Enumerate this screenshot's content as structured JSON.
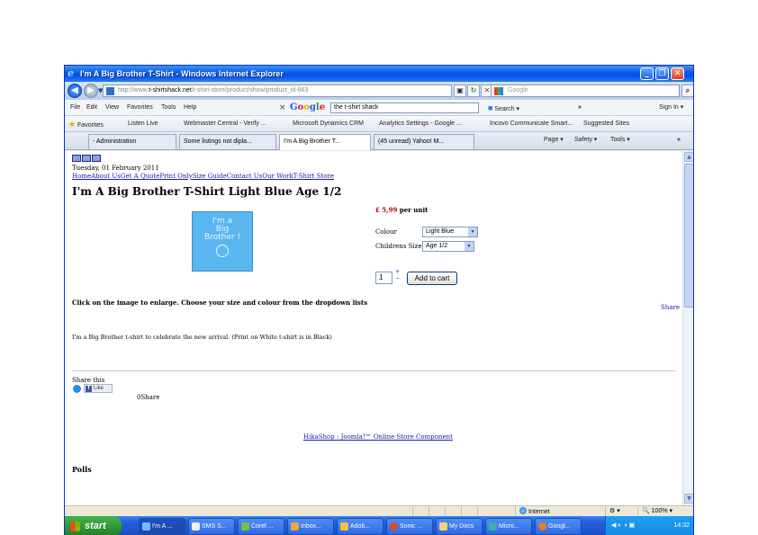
{
  "window": {
    "title": "I'm A Big Brother T-Shirt - Windows Internet Explorer",
    "controls": [
      "_",
      "❐",
      "✕"
    ]
  },
  "address": {
    "scheme": "http://www.",
    "host": "t-shirtshack.net",
    "path": "/t-shirt-store/product/show/product_id-663",
    "search_placeholder": "Google"
  },
  "menu": {
    "items": [
      "File",
      "Edit",
      "View",
      "Favorites",
      "Tools",
      "Help"
    ],
    "google_search_value": "the t-shirt shack",
    "search_label": "Search",
    "sign_in": "Sign In"
  },
  "favorites": {
    "label": "Favorites",
    "links": [
      "Listen Live",
      "Webmaster Central - Verify ...",
      "Microsoft Dynamics CRM",
      "Analytics Settings - Google ...",
      "Incovo  Communicate Smart...",
      "Suggested Sites"
    ]
  },
  "tabs": {
    "items": [
      "- Administration",
      "Some listings not dipla...",
      "I'm A Big Brother T...",
      "(45 unread) Yahoo! M..."
    ],
    "commands": [
      "Page",
      "Safety",
      "Tools"
    ]
  },
  "page": {
    "date": "Tuesday, 01 February 2011",
    "nav": [
      "Home",
      "About Us",
      "Get A Quote",
      "Print Only",
      "Size Guide",
      "Contact Us",
      "Our Work",
      "T-Shirt Store"
    ],
    "title": "I'm A Big Brother T-Shirt Light Blue Age 1/2",
    "image_text": [
      "I'm a",
      "Big",
      "Brother !"
    ],
    "price": "£ 5,99",
    "price_suffix": "per unit",
    "colour_label": "Colour",
    "colour_value": "Light Blue",
    "size_label": "Childrens Size",
    "size_value": "Age 1/2",
    "quantity": "1",
    "add_to_cart": "Add to cart",
    "instructions": "Click on the image to enlarge. Choose your size and colour from the dropdown lists",
    "share_link": "Share",
    "description": "I'm a Big Brother t-shirt to celebrate the new arrival. (Print on White t-shirt is in Black)",
    "share_this": "Share this",
    "fb_like": "Like",
    "share_count": "0Share",
    "footer_link": "HikaShop : Joomla!™ Online Store Component",
    "polls": "Polls"
  },
  "status": {
    "zone": "Internet",
    "zoom": "100%"
  },
  "taskbar": {
    "start": "start",
    "tasks": [
      "I'm A ...",
      "SMS S...",
      "Corel ...",
      "Inbox...",
      "Adob...",
      "Sonic ...",
      "My Docs",
      "Micro...",
      "Googl..."
    ],
    "clock": "14:32"
  },
  "colors": {
    "title_bar": "#0a59e0",
    "price": "#b00000",
    "link": "#1a1aa6",
    "product_bg": "#5ab6ee",
    "taskbar": "#245edb",
    "start": "#2f9233"
  }
}
